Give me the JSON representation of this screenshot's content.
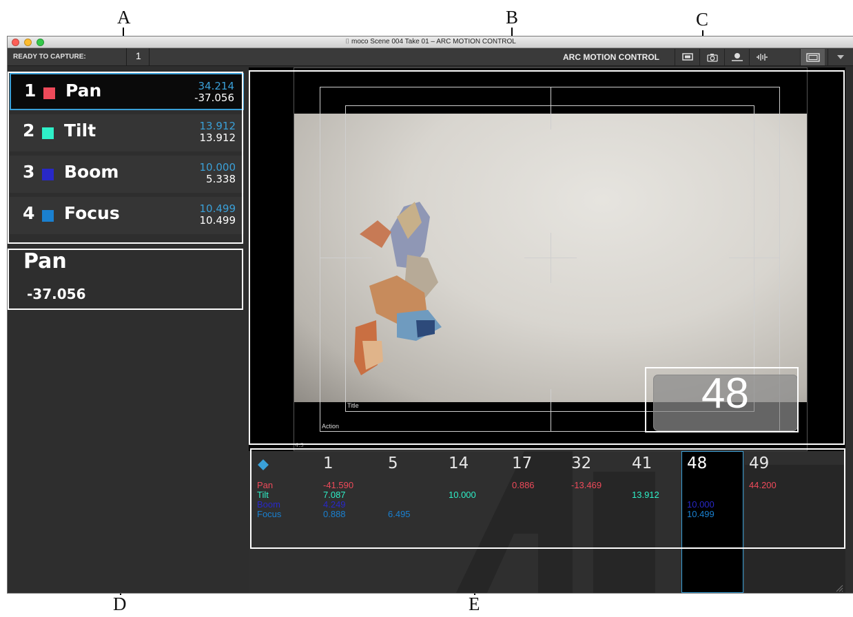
{
  "callouts": {
    "a": "A",
    "b": "B",
    "c": "C",
    "d": "D",
    "e": "E"
  },
  "window": {
    "title": "moco  Scene 004  Take 01 – ARC MOTION CONTROL"
  },
  "toolbar": {
    "ready_label": "READY TO CAPTURE:",
    "ready_count": "1",
    "brand": "ARC MOTION CONTROL",
    "buttons": [
      "monitor-icon",
      "camera-icon",
      "position-icon",
      "waveform-icon",
      "frame-icon",
      "dropdown-icon"
    ]
  },
  "axes": [
    {
      "num": "1",
      "name": "Pan",
      "color": "#ee4a5a",
      "target": "34.214",
      "current": "-37.056",
      "selected": true
    },
    {
      "num": "2",
      "name": "Tilt",
      "color": "#2ef0c8",
      "target": "13.912",
      "current": "13.912",
      "selected": false
    },
    {
      "num": "3",
      "name": "Boom",
      "color": "#2828c8",
      "target": "10.000",
      "current": "5.338",
      "selected": false
    },
    {
      "num": "4",
      "name": "Focus",
      "color": "#1a80d0",
      "target": "10.499",
      "current": "10.499",
      "selected": false
    }
  ],
  "readout": {
    "name": "Pan",
    "value": "-37.056"
  },
  "viewer": {
    "title_safe_label": "Title",
    "action_safe_label": "Action",
    "aspect_label": "4:3",
    "frame_counter": "48"
  },
  "timeline": {
    "row_labels": [
      {
        "name": "Pan",
        "color": "#ee4a5a"
      },
      {
        "name": "Tilt",
        "color": "#2ef0c8"
      },
      {
        "name": "Boom",
        "color": "#2828c8"
      },
      {
        "name": "Focus",
        "color": "#1a80d0"
      }
    ],
    "keyframes": [
      {
        "frame": "1",
        "pan": "-41.590",
        "tilt": "7.087",
        "boom": "4.249",
        "focus": "0.888"
      },
      {
        "frame": "5",
        "pan": "",
        "tilt": "",
        "boom": "",
        "focus": "6.495"
      },
      {
        "frame": "14",
        "pan": "",
        "tilt": "10.000",
        "boom": "",
        "focus": ""
      },
      {
        "frame": "17",
        "pan": "0.886",
        "tilt": "",
        "boom": "",
        "focus": ""
      },
      {
        "frame": "32",
        "pan": "-13.469",
        "tilt": "",
        "boom": "",
        "focus": ""
      },
      {
        "frame": "41",
        "pan": "",
        "tilt": "13.912",
        "boom": "",
        "focus": ""
      },
      {
        "frame": "48",
        "pan": "",
        "tilt": "",
        "boom": "10.000",
        "focus": "10.499"
      },
      {
        "frame": "49",
        "pan": "44.200",
        "tilt": "",
        "boom": "",
        "focus": ""
      }
    ],
    "selected_frame": "48",
    "watermark_text": "ARC"
  }
}
